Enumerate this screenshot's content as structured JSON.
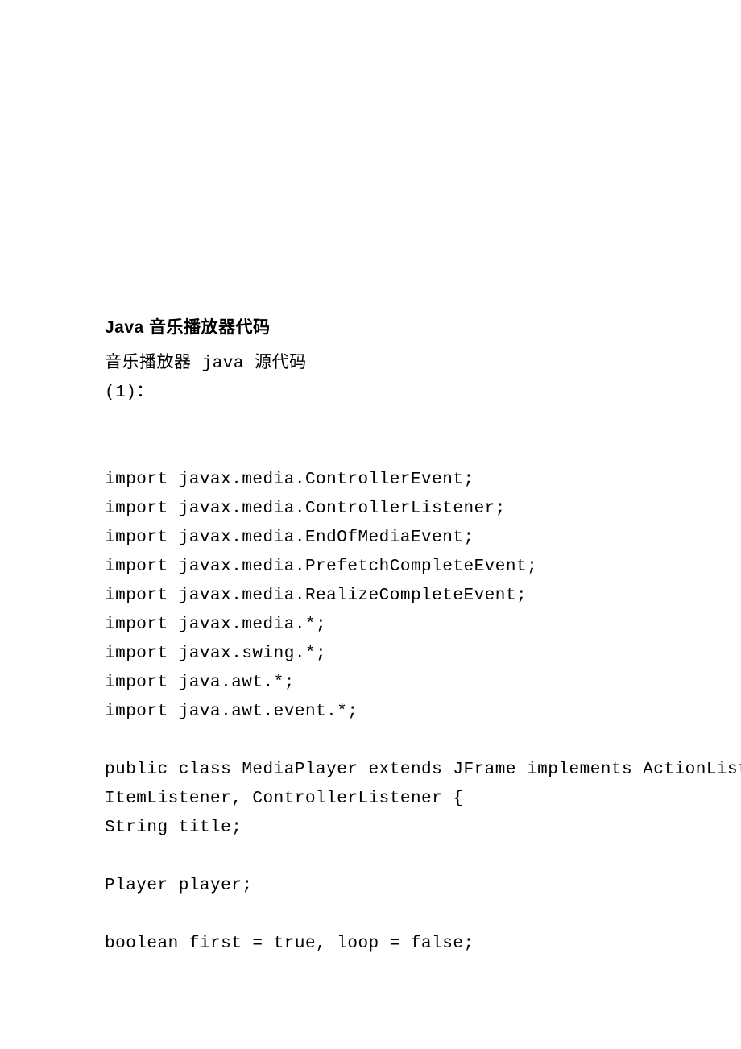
{
  "title": "Java 音乐播放器代码",
  "lines": [
    "音乐播放器 java 源代码",
    "(1)："
  ],
  "code": [
    "import javax.media.ControllerEvent;",
    "import javax.media.ControllerListener;",
    "import javax.media.EndOfMediaEvent;",
    "import javax.media.PrefetchCompleteEvent;",
    "import javax.media.RealizeCompleteEvent;",
    "import javax.media.*;",
    "import javax.swing.*;",
    "import java.awt.*;",
    "import java.awt.event.*;",
    "",
    "public class MediaPlayer extends JFrame implements ActionListener,",
    "ItemListener, ControllerListener {",
    "String title;",
    "",
    "Player player;",
    "",
    "boolean first = true, loop = false;"
  ]
}
